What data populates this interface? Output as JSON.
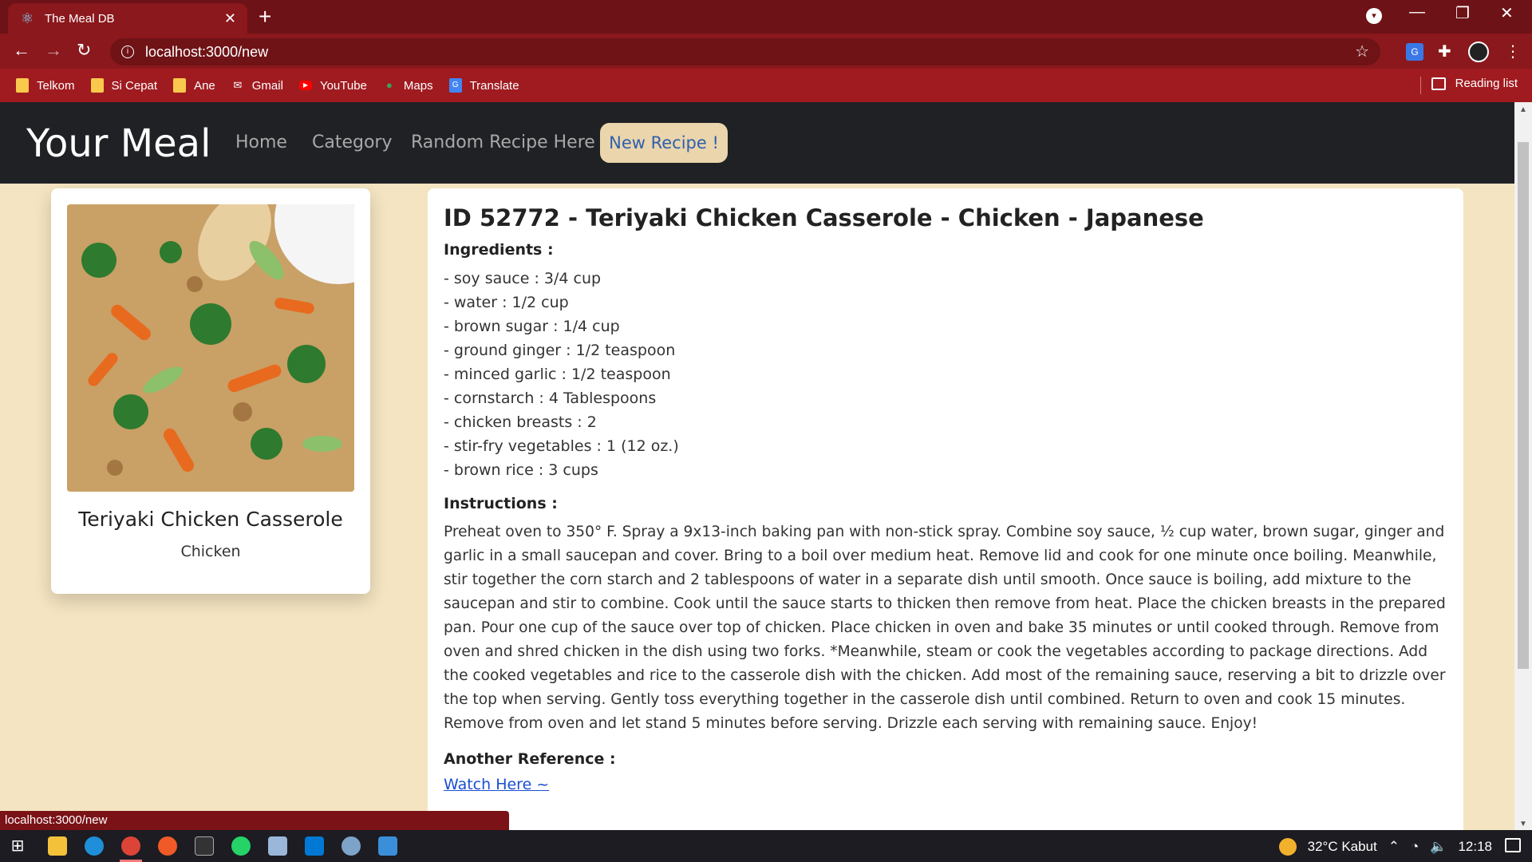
{
  "browser": {
    "tab_title": "The Meal DB",
    "url": "localhost:3000/new",
    "bookmarks": [
      {
        "label": "Telkom",
        "icon": "folder-icon"
      },
      {
        "label": "Si Cepat",
        "icon": "folder-icon"
      },
      {
        "label": "Ane",
        "icon": "folder-icon"
      },
      {
        "label": "Gmail",
        "icon": "gmail-icon"
      },
      {
        "label": "YouTube",
        "icon": "youtube-icon"
      },
      {
        "label": "Maps",
        "icon": "maps-icon"
      },
      {
        "label": "Translate",
        "icon": "translate-icon"
      }
    ],
    "reading_list": "Reading list",
    "status_url": "localhost:3000/new"
  },
  "navbar": {
    "brand": "Your Meal",
    "links": [
      "Home",
      "Category",
      "Random Recipe Here !"
    ],
    "active": "New Recipe !"
  },
  "meal": {
    "name": "Teriyaki Chicken Casserole",
    "category": "Chicken",
    "title": "ID 52772 - Teriyaki Chicken Casserole - Chicken - Japanese",
    "ingredients_heading": "Ingredients :",
    "ingredients": [
      "- soy sauce : 3/4 cup",
      "- water : 1/2 cup",
      "- brown sugar : 1/4 cup",
      "- ground ginger : 1/2 teaspoon",
      "- minced garlic : 1/2 teaspoon",
      "- cornstarch : 4 Tablespoons",
      "- chicken breasts : 2",
      "- stir-fry vegetables : 1 (12 oz.)",
      "- brown rice : 3 cups"
    ],
    "instructions_heading": "Instructions :",
    "instructions": "Preheat oven to 350° F. Spray a 9x13-inch baking pan with non-stick spray. Combine soy sauce, ½ cup water, brown sugar, ginger and garlic in a small saucepan and cover. Bring to a boil over medium heat. Remove lid and cook for one minute once boiling. Meanwhile, stir together the corn starch and 2 tablespoons of water in a separate dish until smooth. Once sauce is boiling, add mixture to the saucepan and stir to combine. Cook until the sauce starts to thicken then remove from heat. Place the chicken breasts in the prepared pan. Pour one cup of the sauce over top of chicken. Place chicken in oven and bake 35 minutes or until cooked through. Remove from oven and shred chicken in the dish using two forks. *Meanwhile, steam or cook the vegetables according to package directions. Add the cooked vegetables and rice to the casserole dish with the chicken. Add most of the remaining sauce, reserving a bit to drizzle over the top when serving. Gently toss everything together in the casserole dish until combined. Return to oven and cook 15 minutes. Remove from oven and let stand 5 minutes before serving. Drizzle each serving with remaining sauce. Enjoy!",
    "reference_heading": "Another Reference :",
    "reference_link": "Watch Here ~"
  },
  "taskbar": {
    "weather": "32°C  Kabut",
    "time": "12:18"
  },
  "colors": {
    "page_bg": "#f4e4c1",
    "navbar_bg": "#1f2125",
    "active_nav_bg": "#ead5ac",
    "chrome_tab": "#8a181d"
  }
}
